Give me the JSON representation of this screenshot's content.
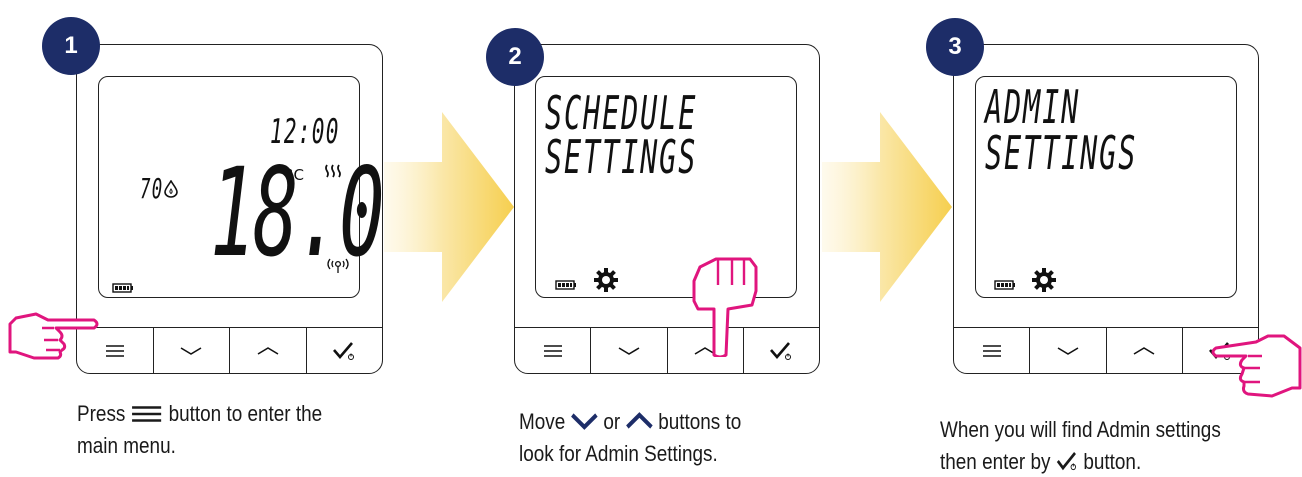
{
  "steps": [
    {
      "number": "1",
      "screen": {
        "time": "12:00",
        "humidity": "70",
        "temperature": "18.0",
        "unit": "°C"
      },
      "caption_line1_before": "Press",
      "caption_line1_after": "button to enter the",
      "caption_line2": "main menu."
    },
    {
      "number": "2",
      "screen": {
        "line1": "SCHEDULE",
        "line2": "SETTINGS"
      },
      "caption_line1_a": "Move",
      "caption_line1_b": "or",
      "caption_line1_c": "buttons to",
      "caption_line2": "look for Admin Settings."
    },
    {
      "number": "3",
      "screen": {
        "line1": "ADMIN",
        "line2": "SETTINGS"
      },
      "caption_line1": "When you will find Admin settings",
      "caption_line2_before": "then enter by",
      "caption_line2_after": "button."
    }
  ],
  "colors": {
    "badge": "#1d2d68",
    "hand": "#e0157e",
    "arrow": "#f7d25a"
  },
  "icons": [
    "menu-icon",
    "chevron-down-icon",
    "chevron-up-icon",
    "check-power-icon",
    "battery-icon",
    "gear-icon",
    "hand-pointer-icon"
  ]
}
